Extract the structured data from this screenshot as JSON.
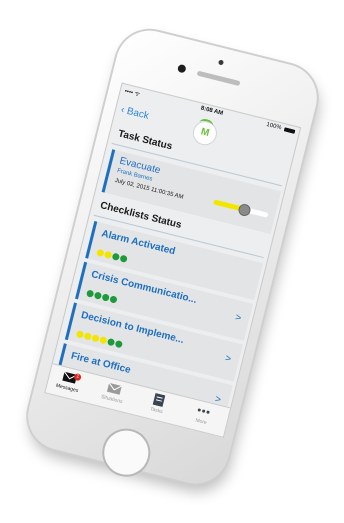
{
  "status_bar": {
    "carrier": "•••• ᯤ",
    "time": "8:08 AM",
    "battery": "100%"
  },
  "nav": {
    "back_label": "‹ Back",
    "logo_letter": "M"
  },
  "task_status": {
    "title": "Task Status",
    "task": {
      "name": "Evacuate",
      "person": "Frank Barnes",
      "datetime": "July 02, 2015 11:00:35 AM",
      "progress": 0.55
    }
  },
  "checklists": {
    "title": "Checklists Status",
    "items": [
      {
        "label": "Alarm Activated",
        "dots": [
          "yellow",
          "yellow",
          "green",
          "green"
        ]
      },
      {
        "label": "Crisis Communicatio...",
        "dots": [
          "green",
          "green",
          "green",
          "green"
        ]
      },
      {
        "label": "Decision to Impleme...",
        "dots": [
          "yellow",
          "yellow",
          "yellow",
          "yellow",
          "green",
          "green"
        ]
      },
      {
        "label": "Fire at Office",
        "dots": [
          "yellow",
          "yellow",
          "yellow",
          "green",
          "green"
        ]
      }
    ]
  },
  "tabs": [
    {
      "label": "Messages",
      "badge": "1",
      "icon": "envelope-icon"
    },
    {
      "label": "Situations",
      "icon": "envelope-icon"
    },
    {
      "label": "Tasks",
      "icon": "tasks-icon"
    },
    {
      "label": "More",
      "icon": "more-icon"
    }
  ],
  "colors": {
    "accent": "#1f6fc1",
    "dot_yellow": "#f2e600",
    "dot_green": "#1e9a3a",
    "logo_green": "#6bbf3a",
    "badge_red": "#d9261c"
  }
}
